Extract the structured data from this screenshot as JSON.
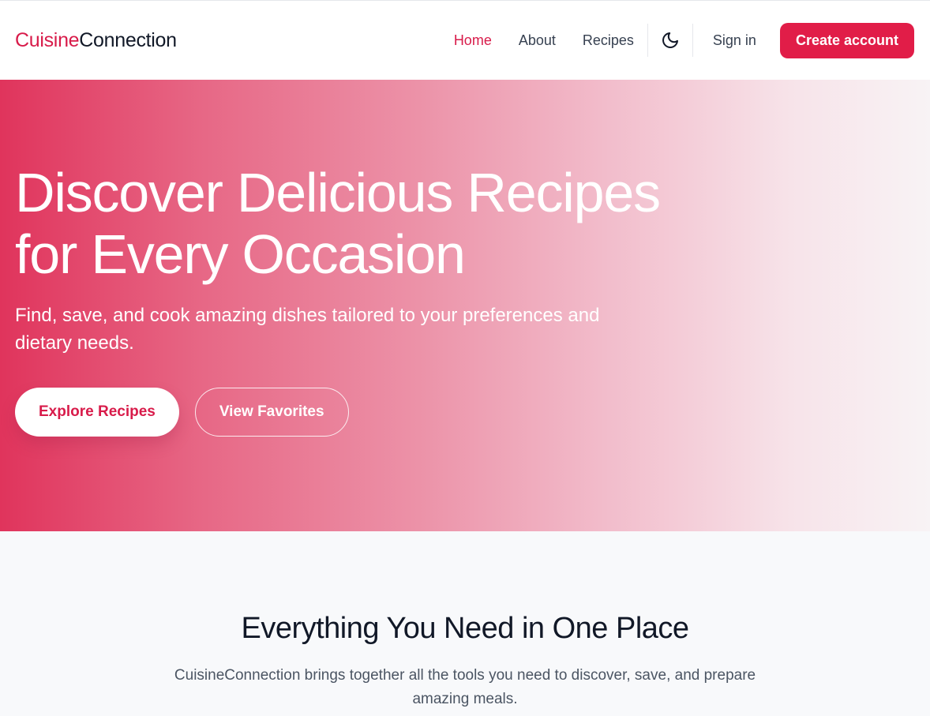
{
  "header": {
    "logo_part1": "Cuisine",
    "logo_part2": "Connection",
    "nav": [
      {
        "label": "Home",
        "active": true
      },
      {
        "label": "About",
        "active": false
      },
      {
        "label": "Recipes",
        "active": false
      }
    ],
    "theme_icon": "moon-icon",
    "sign_in_label": "Sign in",
    "create_account_label": "Create account"
  },
  "hero": {
    "title_line1": "Discover Delicious Recipes",
    "title_line2": "for Every Occasion",
    "subtitle_line1": "Find, save, and cook amazing dishes tailored to your preferences and",
    "subtitle_line2": "dietary needs.",
    "primary_button": "Explore Recipes",
    "secondary_button": "View Favorites"
  },
  "features": {
    "title": "Everything You Need in One Place",
    "subtitle_line1": "CuisineConnection brings together all the tools you need to discover, save, and prepare",
    "subtitle_line2": "amazing meals."
  },
  "colors": {
    "brand": "#e11d48",
    "brand_text": "#d81b4a",
    "dark_text": "#111827",
    "muted_text": "#4b5563"
  }
}
